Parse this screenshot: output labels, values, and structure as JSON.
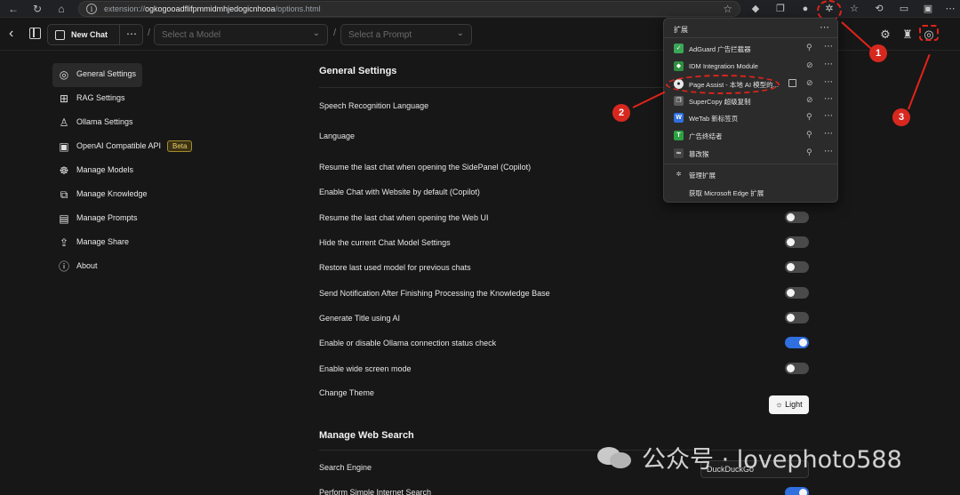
{
  "browser": {
    "url_scheme": "extension://",
    "url_host": "ogkogooadflifpmmidmhjedogicnhooa",
    "url_path": "/options.html"
  },
  "header": {
    "new_chat_label": "New Chat",
    "model_placeholder": "Select a Model",
    "prompt_placeholder": "Select a Prompt",
    "slash": "/"
  },
  "sidebar": {
    "items": [
      {
        "label": "General Settings",
        "icon": "general-settings-icon"
      },
      {
        "label": "RAG Settings",
        "icon": "rag-icon"
      },
      {
        "label": "Ollama Settings",
        "icon": "ollama-icon"
      },
      {
        "label": "OpenAI Compatible API",
        "icon": "chip-icon",
        "badge": "Beta"
      },
      {
        "label": "Manage Models",
        "icon": "brain-icon"
      },
      {
        "label": "Manage Knowledge",
        "icon": "blocks-icon"
      },
      {
        "label": "Manage Prompts",
        "icon": "book-icon"
      },
      {
        "label": "Manage Share",
        "icon": "share-icon"
      },
      {
        "label": "About",
        "icon": "info-icon"
      }
    ]
  },
  "general": {
    "title": "General Settings",
    "speech_lang": "Speech Recognition Language",
    "language": "Language",
    "resume_sidepanel": "Resume the last chat when opening the SidePanel (Copilot)",
    "enable_chat_website": "Enable Chat with Website by default (Copilot)",
    "resume_webui": "Resume the last chat when opening the Web UI",
    "hide_model_settings": "Hide the current Chat Model Settings",
    "restore_model": "Restore last used model for previous chats",
    "send_notification": "Send Notification After Finishing Processing the Knowledge Base",
    "generate_title": "Generate Title using AI",
    "ollama_status": "Enable or disable Ollama connection status check",
    "wide_screen": "Enable wide screen mode",
    "change_theme": "Change Theme",
    "theme_value": "Light"
  },
  "web_search": {
    "title": "Manage Web Search",
    "engine_label": "Search Engine",
    "engine_value": "DuckDuckGo",
    "simple_search": "Perform Simple Internet Search"
  },
  "toggles": {
    "resume_webui": false,
    "hide_model_settings": false,
    "restore_model": false,
    "send_notification": false,
    "generate_title": false,
    "ollama_status": true,
    "wide_screen": false,
    "simple_search": true
  },
  "extensions_popup": {
    "title": "扩展",
    "items": [
      {
        "label": "AdGuard 广告拦截器",
        "icon_color": "#3aa757"
      },
      {
        "label": "IDM Integration Module",
        "icon_color": "#2f8f3f"
      },
      {
        "label": "Page Assist - 本地 AI 模型的...",
        "icon_color": "#e8e8e8"
      },
      {
        "label": "SuperCopy 超级复制",
        "icon_color": "#5a5a5a"
      },
      {
        "label": "WeTab 新标签页",
        "icon_color": "#2f6fe0"
      },
      {
        "label": "广告终结者",
        "icon_color": "#2ea043"
      },
      {
        "label": "篡改猴",
        "icon_color": "#444444"
      }
    ],
    "manage_label": "管理扩展",
    "get_label": "获取 Microsoft Edge 扩展"
  },
  "annotations": [
    "1",
    "2",
    "3"
  ],
  "watermark": "公众号 · lovephoto588",
  "colors": {
    "accent": "#2f6fe0",
    "annotation": "#e2231a",
    "beta_badge": "#f0d26a"
  }
}
